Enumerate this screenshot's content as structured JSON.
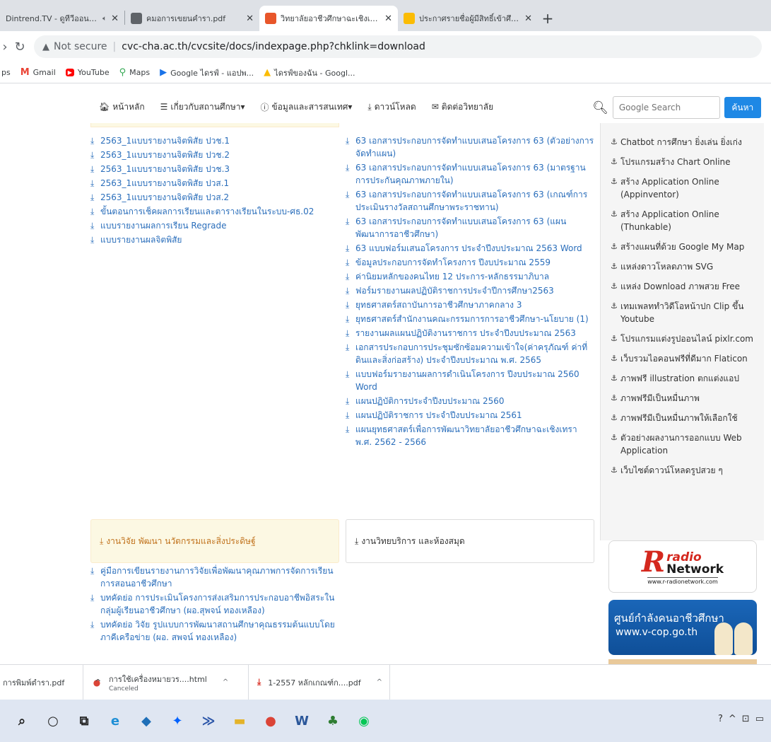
{
  "browser": {
    "tabs": [
      {
        "title": "Dintrend.TV - ดูทีวีออนไลน์ ภ",
        "favicon_color": "#ffffff",
        "active": false,
        "audio": true
      },
      {
        "title": "คมอการเขยนคำรา.pdf",
        "favicon_color": "#5f6368",
        "active": false,
        "audio": false
      },
      {
        "title": "วิทยาลัยอาชีวศึกษาฉะเชิงเทรา สถาบัน",
        "favicon_color": "#e8562a",
        "active": true,
        "audio": false
      },
      {
        "title": "ประกาศรายชื่อผู้มีสิทธิ์เข้าศึกษาต่อ(โค",
        "favicon_color": "#fbbc04",
        "active": false,
        "audio": false
      }
    ],
    "new_tab": "+",
    "address": {
      "security": "Not secure",
      "url": "cvc-cha.ac.th/cvcsite/docs/indexpage.php?chklink=download"
    },
    "bookmarks": [
      {
        "label": "ps",
        "icon": "apps-icon",
        "color": "#5f6368"
      },
      {
        "label": "Gmail",
        "icon": "gmail-icon",
        "color": "#ea4335"
      },
      {
        "label": "YouTube",
        "icon": "youtube-icon",
        "color": "#ff0000"
      },
      {
        "label": "Maps",
        "icon": "maps-icon",
        "color": "#34a853"
      },
      {
        "label": "Google ไดรฟ์ - แอปพ...",
        "icon": "play-icon",
        "color": "#1a73e8"
      },
      {
        "label": "ไดรฟ์ของฉัน - Googl...",
        "icon": "drive-icon",
        "color": "#fbbc04"
      }
    ]
  },
  "site": {
    "nav": [
      {
        "label": "หน้าหลัก",
        "icon": "home-icon"
      },
      {
        "label": "เกี่ยวกับสถานศึกษา▾",
        "icon": "list-icon"
      },
      {
        "label": "ข้อมูลและสารสนเทศ▾",
        "icon": "info-icon"
      },
      {
        "label": "ดาวน์โหลด",
        "icon": "download-icon"
      },
      {
        "label": "ติดต่อวิทยาลัย",
        "icon": "mail-icon"
      }
    ],
    "search": {
      "placeholder": "Google Search",
      "button": "ค้นหา"
    },
    "left_list": [
      "2563_1แบบรายงานจิตพิสัย ปวช.1",
      "2563_1แบบรายงานจิตพิสัย ปวช.2",
      "2563_1แบบรายงานจิตพิสัย ปวช.3",
      "2563_1แบบรายงานจิตพิสัย ปวส.1",
      "2563_1แบบรายงานจิตพิสัย ปวส.2",
      "ขั้นตอนการเช็คผลการเรียนและตารางเรียนในระบบ-ศธ.02",
      "แบบรายงานผลการเรียน Regrade",
      "แบบรายงานผลจิตพิสัย"
    ],
    "mid_list": [
      "63 เอกสารประกอบการจัดทำแบบเสนอโครงการ 63 (ตัวอย่างการจัดทำแผน)",
      "63 เอกสารประกอบการจัดทำแบบเสนอโครงการ 63 (มาตรฐานการประกันคุณภาพภายใน)",
      "63 เอกสารประกอบการจัดทำแบบเสนอโครงการ 63 (เกณฑ์การประเมินรางวัลสถานศึกษาพระราชทาน)",
      "63 เอกสารประกอบการจัดทำแบบเสนอโครงการ 63 (แผนพัฒนาการอาชีวศึกษา)",
      "63 แบบฟอร์มเสนอโครงการ ประจำปีงบประมาณ 2563 Word",
      "ข้อมูลประกอบการจัดทำโครงการ ปีงบประมาณ 2559",
      "ค่านิยมหลักของคนไทย 12 ประการ-หลักธรรมาภิบาล",
      "ฟอร์มรายงานผลปฏิบัติราชการประจำปีการศึกษา2563",
      "ยุทธศาสตร์สถาบันการอาชีวศึกษาภาคกลาง 3",
      "ยุทธศาสตร์สำนักงานคณะกรรมการการอาชีวศึกษา-นโยบาย (1)",
      "รายงานผลแผนปฏิบัติงานราชการ ประจำปีงบประมาณ 2563",
      "เอกสารประกอบการประชุมซักซ้อมความเข้าใจ(ค่าครุภัณฑ์ ค่าที่ดินและสิ่งก่อสร้าง) ประจำปีงบประมาณ พ.ศ. 2565",
      "แบบฟอร์มรายงานผลการดำเนินโครงการ ปีงบประมาณ 2560 Word",
      "แผนปฏิบัติการประจำปีงบประมาณ 2560",
      "แผนปฏิบัติราชการ ประจำปีงบประมาณ 2561",
      "แผนยุทธศาสตร์เพื่อการพัฒนาวิทยาลัยอาชีวศึกษาฉะเชิงเทรา พ.ศ. 2562 - 2566"
    ],
    "sidebar_links": [
      "Chatbot การศึกษา ยิ่งเล่น ยิ่งเก่ง",
      "โปรแกรมสร้าง Chart Online",
      "สร้าง Application Online (Appinventor)",
      "สร้าง Application Online (Thunkable)",
      "สร้างแผนที่ด้วย Google My Map",
      "แหล่งดาวโหลดภาพ SVG",
      "แหล่ง Download ภาพสวย Free",
      "เทมเพลททำวิดีโอหน้าปก Clip ขึ้น Youtube",
      "โปรแกรมแต่งรูปออนไลน์ pixlr.com",
      "เว็บรวมไอคอนฟรีที่ดีมาก Flaticon",
      "ภาพฟรี illustration ตกแต่งแอป",
      "ภาพฟรีมีเป็นหมื่นภาพ",
      "ภาพฟรีมีเป็นหมื่นภาพให้เลือกใช้",
      "ตัวอย่างผลงานการออกแบบ Web Application",
      "เว็บไซต์ดาวน์โหลดรูปสวย ๆ"
    ],
    "panel_research": "งานวิจัย พัฒนา นวัตกรรมและสิ่งประดิษฐ์",
    "panel_library": "งานวิทยบริการ และห้องสมุด",
    "research_list": [
      "คู่มือการเขียนรายงานการวิจัยเพื่อพัฒนาคุณภาพการจัดการเรียน การสอนอาชีวศึกษา",
      "บทคัดย่อ การประเมินโครงการส่งเสริมการประกอบอาชีพอิสระในกลุ่มผู้เรียนอาชีวศึกษา (ผอ.สุพจน์ ทองเหลือง)",
      "บทคัดย่อ วิจัย รูปแบบการพัฒนาสถานศึกษาคุณธรรมต้นแบบโดยภาคีเครือข่าย (ผอ. สพจน์ ทองเหลือง)"
    ],
    "banner_radio": {
      "word1": "radio",
      "word2": "Network",
      "url": "www.r-radionetwork.com"
    },
    "banner_vcop": {
      "line1": "ศูนย์กำลังคนอาชีวศึกษา",
      "line2": "www.v-cop.go.th"
    }
  },
  "downloads": [
    {
      "name": "การพิมพ์ตำรา.pdf",
      "status": "",
      "icon": "pdf-icon"
    },
    {
      "name": "การใช้เครื่องหมายวร....html",
      "status": "Canceled",
      "icon": "chrome-icon"
    },
    {
      "name": "1-2557 หลักเกณฑ์ก....pdf",
      "status": "",
      "icon": "pdf-icon"
    }
  ],
  "taskbar": {
    "apps": [
      {
        "name": "search",
        "glyph": "⌕",
        "color": "#222222"
      },
      {
        "name": "cortana",
        "glyph": "○",
        "color": "#222222"
      },
      {
        "name": "task-view",
        "glyph": "⧉",
        "color": "#222222"
      },
      {
        "name": "edge",
        "glyph": "e",
        "color": "#1f8fd6"
      },
      {
        "name": "store",
        "glyph": "◆",
        "color": "#1f6fb8"
      },
      {
        "name": "dropbox",
        "glyph": "✦",
        "color": "#0061fe"
      },
      {
        "name": "powershell",
        "glyph": "≫",
        "color": "#2a55a8"
      },
      {
        "name": "explorer",
        "glyph": "▬",
        "color": "#e4b32a"
      },
      {
        "name": "chrome",
        "glyph": "●",
        "color": "#db4437"
      },
      {
        "name": "word",
        "glyph": "W",
        "color": "#2b579a"
      },
      {
        "name": "app",
        "glyph": "♣",
        "color": "#2e7d32"
      },
      {
        "name": "line",
        "glyph": "◉",
        "color": "#06c755"
      }
    ],
    "tray": [
      "?",
      "^",
      "⊡",
      "▭"
    ]
  },
  "colors": {
    "link": "#2a6ebb",
    "accent": "#1e88e5",
    "warning_bg": "#fcf8e3",
    "warning_text": "#c0711b"
  }
}
